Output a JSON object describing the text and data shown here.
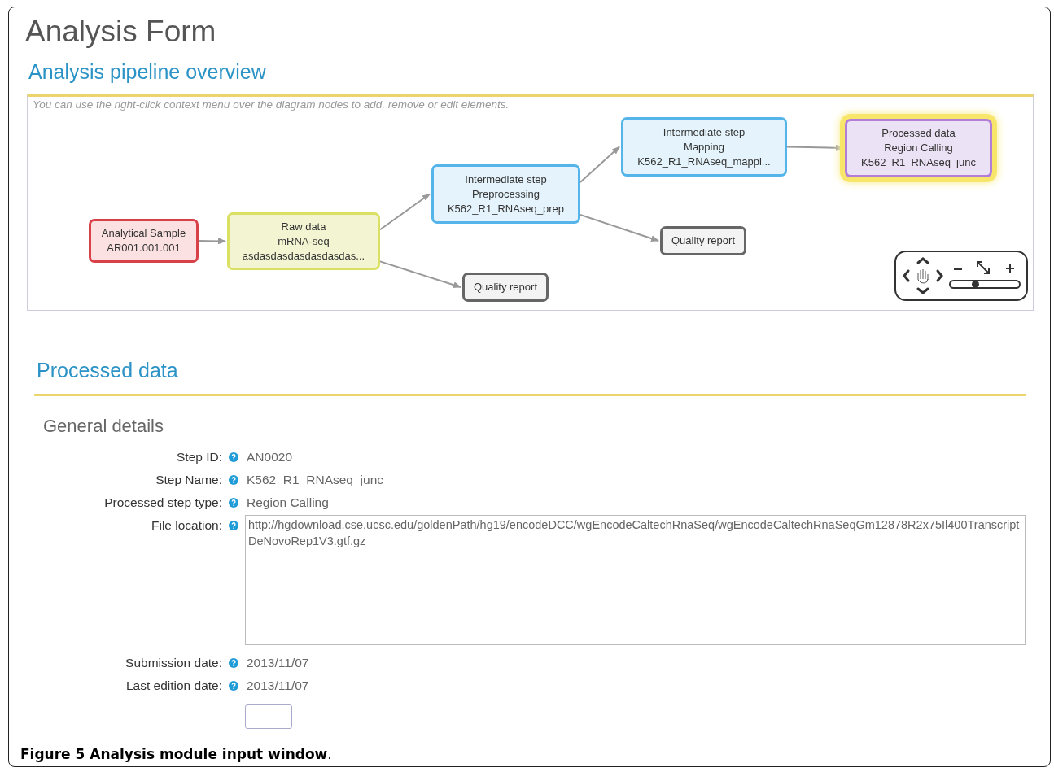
{
  "page_title": "Analysis Form",
  "pipeline": {
    "title": "Analysis pipeline overview",
    "hint": "You can use the right-click context menu over the diagram nodes to add, remove or edit elements.",
    "nodes": [
      {
        "kind": "sample",
        "selected": false,
        "lines": [
          "Analytical Sample",
          "AR001.001.001"
        ],
        "children": [
          {
            "kind": "raw",
            "selected": false,
            "lines": [
              "Raw data",
              "mRNA-seq",
              "asdasdasdasdasdasdas..."
            ],
            "children": [
              {
                "kind": "intermediate",
                "selected": false,
                "lines": [
                  "Intermediate step",
                  "Preprocessing",
                  "K562_R1_RNAseq_prep"
                ],
                "children": [
                  {
                    "kind": "intermediate",
                    "selected": false,
                    "lines": [
                      "Intermediate step",
                      "Mapping",
                      "K562_R1_RNAseq_mappi..."
                    ],
                    "children": [
                      {
                        "kind": "processed",
                        "selected": true,
                        "lines": [
                          "Processed data",
                          "Region Calling",
                          "K562_R1_RNAseq_junc"
                        ]
                      }
                    ]
                  },
                  {
                    "kind": "report",
                    "selected": false,
                    "lines": [
                      "Quality report"
                    ]
                  }
                ]
              },
              {
                "kind": "report",
                "selected": false,
                "lines": [
                  "Quality report"
                ]
              }
            ]
          }
        ]
      }
    ],
    "zoom": {
      "level": 0.36
    }
  },
  "section_title": "Processed data",
  "subsection_title": "General details",
  "fields": [
    {
      "kind": "text",
      "label": "Step ID:",
      "value": "AN0020"
    },
    {
      "kind": "text",
      "label": "Step Name:",
      "value": "K562_R1_RNAseq_junc"
    },
    {
      "kind": "text",
      "label": "Processed step type:",
      "value": "Region Calling"
    },
    {
      "kind": "textarea",
      "label": "File location:",
      "value": "http://hgdownload.cse.ucsc.edu/goldenPath/hg19/encodeDCC/wgEncodeCaltechRnaSeq/wgEncodeCaltechRnaSeqGm12878R2x75Il400TranscriptDeNovoRep1V3.gtf.gz"
    },
    {
      "kind": "text",
      "label": "Submission date:",
      "value": "2013/11/07"
    },
    {
      "kind": "text",
      "label": "Last edition date:",
      "value": "2013/11/07"
    }
  ],
  "caption": "**Figure 5 Analysis module input window**."
}
